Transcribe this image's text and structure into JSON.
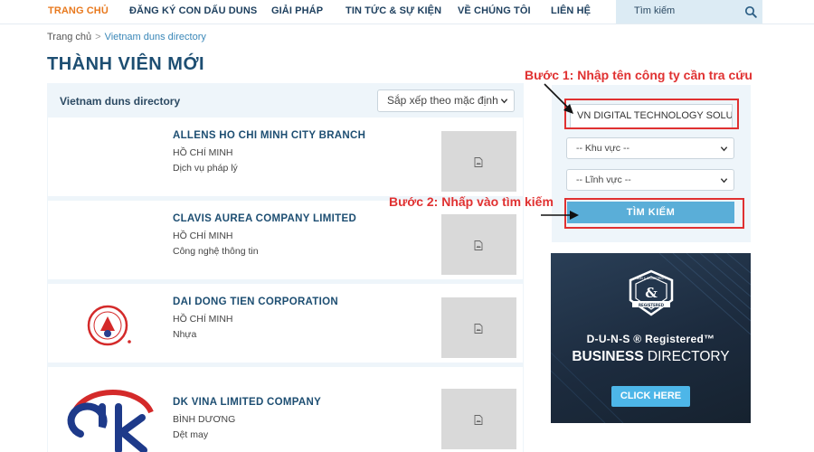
{
  "nav": {
    "items": [
      "TRANG CHỦ",
      "ĐĂNG KÝ CON DẤU DUNS",
      "GIẢI PHÁP",
      "TIN TỨC & SỰ KIỆN",
      "VỀ CHÚNG TÔI",
      "LIÊN HỆ"
    ],
    "search_placeholder": "Tìm kiếm"
  },
  "breadcrumb": {
    "home": "Trang chủ",
    "separator": ">",
    "current": "Vietnam duns directory"
  },
  "page_title": "THÀNH VIÊN MỚI",
  "list": {
    "header": "Vietnam duns directory",
    "sort_selected": "Sắp xếp theo mặc định",
    "companies": [
      {
        "name": "ALLENS HO CHI MINH CITY BRANCH",
        "city": "HỒ CHÍ MINH",
        "field": "Dịch vụ pháp lý"
      },
      {
        "name": "CLAVIS AUREA COMPANY LIMITED",
        "city": "HỒ CHÍ MINH",
        "field": "Công nghệ thông tin"
      },
      {
        "name": "DAI DONG TIEN CORPORATION",
        "city": "HỒ CHÍ MINH",
        "field": "Nhựa"
      },
      {
        "name": "DK VINA LIMITED COMPANY",
        "city": "BÌNH DƯƠNG",
        "field": "Dệt may"
      }
    ]
  },
  "search": {
    "input_value": "VN DIGITAL TECHNOLOGY SOLU",
    "region_selected": "-- Khu vực --",
    "sector_selected": "-- Lĩnh vực --",
    "button": "TÌM KIẾM"
  },
  "annotations": {
    "step1": "Bước 1: Nhập tên công ty cần tra cứu",
    "step2": "Bước 2: Nhấp vào tìm kiếm"
  },
  "banner": {
    "line1": "D-U-N-S ® Registered™",
    "line2_bold": "BUSINESS",
    "line2_rest": " DIRECTORY",
    "cta": "CLICK HERE",
    "seal_top": "DUN & BRADSTREET",
    "seal_bottom": "REGISTERED"
  },
  "colors": {
    "accent": "#e8791e",
    "brand": "#1d4e72",
    "annotation": "#e03131",
    "button": "#5aaed8"
  }
}
